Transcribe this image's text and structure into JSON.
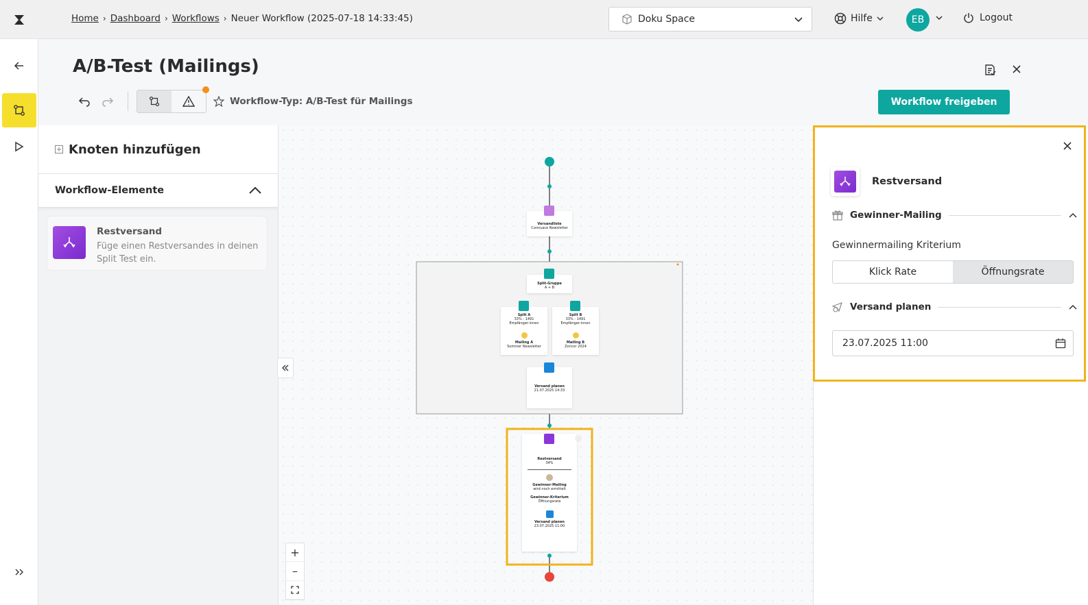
{
  "breadcrumb": {
    "home": "Home",
    "dashboard": "Dashboard",
    "workflows": "Workflows",
    "current": "Neuer Workflow (2025-07-18 14:33:45)"
  },
  "space": {
    "label": "Doku Space"
  },
  "topbar": {
    "help": "Hilfe",
    "avatar": "EB",
    "logout": "Logout"
  },
  "page": {
    "title": "A/B-Test (Mailings)",
    "workflow_type": "Workflow-Typ: A/B-Test für Mailings",
    "release_button": "Workflow freigeben"
  },
  "left_panel": {
    "title": "Knoten hinzufügen",
    "section": "Workflow-Elemente",
    "card_title": "Restversand",
    "card_desc": "Füge einen Restversandes in deinen Split Test ein."
  },
  "right_panel": {
    "title": "Restversand",
    "section_winner": "Gewinner-Mailing",
    "criterion_label": "Gewinnermailing Kriterium",
    "option_click": "Klick Rate",
    "option_open": "Öffnungsrate",
    "selected": "Öffnungsrate",
    "section_schedule": "Versand planen",
    "date_value": "23.07.2025 11:00"
  },
  "canvas": {
    "node_list": {
      "title": "Versandliste",
      "sub": "Connuace Newsletter"
    },
    "node_split": {
      "title": "Split-Gruppe",
      "sub": "A + B"
    },
    "split_a": {
      "title": "Split A",
      "line1": "33% - 1491",
      "line2": "Empfänger:innen",
      "mailing_title": "Mailing A",
      "mailing_sub": "Sommer Newsletter"
    },
    "split_b": {
      "title": "Split B",
      "line1": "33% - 1491",
      "line2": "Empfänger:innen",
      "mailing_title": "Mailing B",
      "mailing_sub": "Zoncor 2024"
    },
    "node_schedule": {
      "title": "Versand planen",
      "sub": "21.07.2025 14:33"
    },
    "rest": {
      "title": "Restversand",
      "percent": "34%",
      "winner_title": "Gewinner-Mailing",
      "winner_sub": "wird noch ermittelt",
      "criterion_title": "Gewinner-Kriterium",
      "criterion_sub": "Öffnungsrate",
      "schedule_title": "Versand planen",
      "schedule_sub": "23.07.2025 11:00"
    }
  },
  "colors": {
    "accent": "#0ea7a0",
    "highlight": "#f1b21b",
    "active_rail": "#f6df2c",
    "purple": "#8a36d8"
  }
}
